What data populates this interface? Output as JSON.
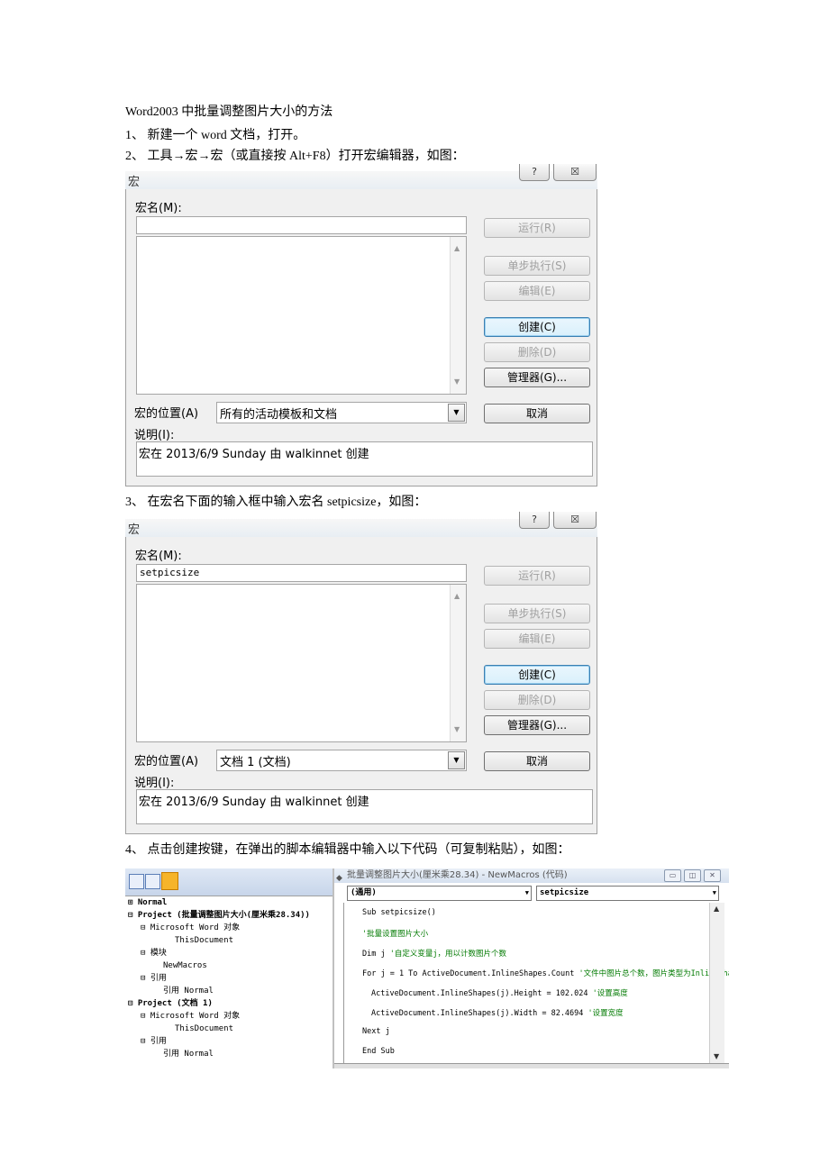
{
  "doc": {
    "title": "Word2003 中批量调整图片大小的方法",
    "step1": "1、 新建一个 word 文档，打开。",
    "step2": "2、 工具→宏→宏（或直接按 Alt+F8）打开宏编辑器，如图：",
    "step3": "3、 在宏名下面的输入框中输入宏名 setpicsize，如图：",
    "step4": "4、 点击创建按键，在弹出的脚本编辑器中输入以下代码（可复制粘贴），如图："
  },
  "dialog1": {
    "title": "宏",
    "help_icon": "?",
    "close_icon": "☒",
    "name_label": "宏名(M):",
    "name_value": "",
    "run": "运行(R)",
    "step": "单步执行(S)",
    "edit": "编辑(E)",
    "create": "创建(C)",
    "delete": "删除(D)",
    "organizer": "管理器(G)...",
    "cancel": "取消",
    "location_label": "宏的位置(A)",
    "location_value": "所有的活动模板和文档",
    "desc_label": "说明(I):",
    "desc_value": "宏在 2013/6/9 Sunday 由 walkinnet 创建"
  },
  "dialog2": {
    "title": "宏",
    "help_icon": "?",
    "close_icon": "☒",
    "name_label": "宏名(M):",
    "name_value": "setpicsize",
    "run": "运行(R)",
    "step": "单步执行(S)",
    "edit": "编辑(E)",
    "create": "创建(C)",
    "delete": "删除(D)",
    "organizer": "管理器(G)...",
    "cancel": "取消",
    "location_label": "宏的位置(A)",
    "location_value": "文档 1 (文档)",
    "desc_label": "说明(I):",
    "desc_value": "宏在 2013/6/9 Sunday 由 walkinnet 创建"
  },
  "vba": {
    "window_title": "批量调整图片大小(厘米乘28.34) - NewMacros (代码)",
    "object_combo": "(通用)",
    "proc_combo": "setpicsize",
    "tree": [
      "⊞ Normal",
      "⊟ Project (批量调整图片大小(厘米乘28.34))",
      "⊟ Microsoft Word 对象",
      "ThisDocument",
      "⊟ 模块",
      "NewMacros",
      "⊟ 引用",
      "引用 Normal",
      "⊟ Project (文档 1)",
      "⊟ Microsoft Word 对象",
      "ThisDocument",
      "⊟ 引用",
      "引用 Normal"
    ],
    "code": {
      "l1": "Sub setpicsize()",
      "l2": "'批量设置图片大小",
      "l3a": "Dim j ",
      "l3b": "'自定义变量j，用以计数图片个数",
      "l4a": "For j = 1 To ActiveDocument.InlineShapes.Count ",
      "l4b": "'文件中图片总个数，图片类型为InlineShapes",
      "l5a": "ActiveDocument.InlineShapes(j).Height = 102.024 ",
      "l5b": "'设置高度",
      "l6a": "ActiveDocument.InlineShapes(j).Width = 82.4694 ",
      "l6b": "'设置宽度",
      "l7": "Next j",
      "l8": "End Sub"
    }
  }
}
